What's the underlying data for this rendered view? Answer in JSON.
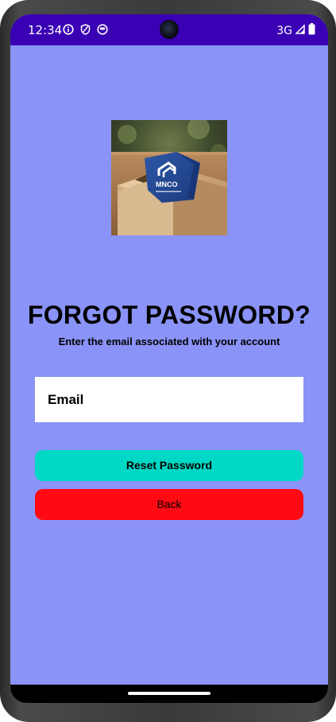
{
  "status_bar": {
    "time": "12:34",
    "left_icons": [
      "info-icon",
      "shield-icon",
      "sync-icon"
    ],
    "network": "3G",
    "right_icons": [
      "signal-icon",
      "battery-icon"
    ],
    "background": "#3a00b4"
  },
  "logo": {
    "icon": "mnco-box-logo",
    "brand_text": "MNCO"
  },
  "page": {
    "title": "FORGOT PASSWORD?",
    "subtitle": "Enter the email associated with your account",
    "background": "#8a93f7"
  },
  "form": {
    "email_placeholder": "Email",
    "email_value": ""
  },
  "buttons": {
    "reset_label": "Reset Password",
    "reset_color": "#00d8c6",
    "back_label": "Back",
    "back_color": "#ff0a12"
  }
}
